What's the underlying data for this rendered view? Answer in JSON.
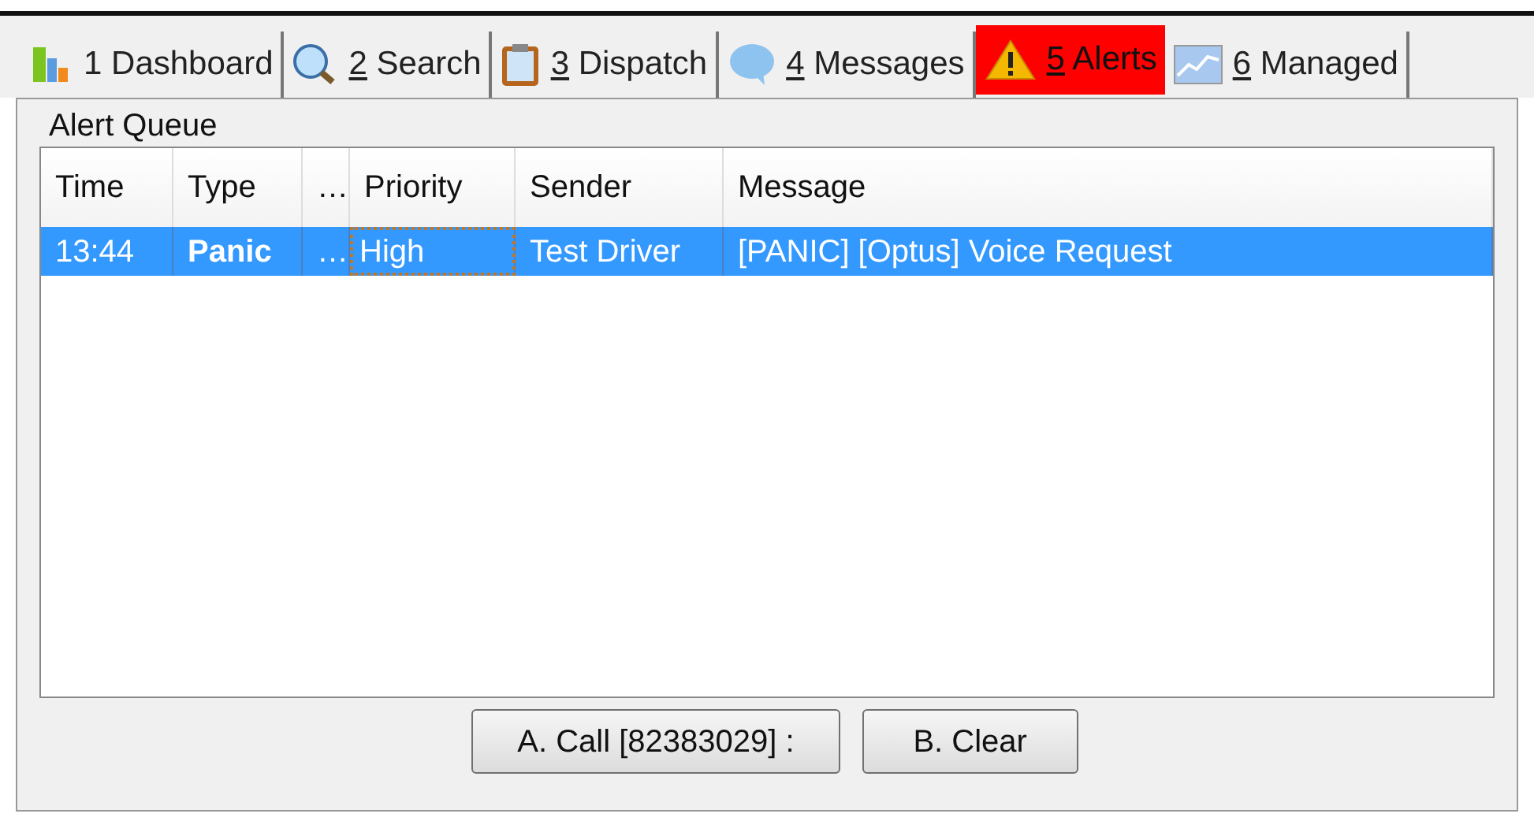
{
  "tabs": [
    {
      "kind": "chart",
      "key": "1",
      "label": "Dashboard",
      "underlined": false,
      "selected": false
    },
    {
      "kind": "search",
      "key": "2",
      "label": "Search",
      "underlined": true,
      "selected": false
    },
    {
      "kind": "clipboard",
      "key": "3",
      "label": "Dispatch",
      "underlined": true,
      "selected": false
    },
    {
      "kind": "bubble",
      "key": "4",
      "label": "Messages",
      "underlined": true,
      "selected": false
    },
    {
      "kind": "warning",
      "key": "5",
      "label": "Alerts",
      "underlined": true,
      "selected": true
    },
    {
      "kind": "graph",
      "key": "6",
      "label": "Managed",
      "underlined": true,
      "selected": false
    }
  ],
  "group": {
    "title": "Alert Queue"
  },
  "table": {
    "columns": [
      "Time",
      "Type",
      "…",
      "Priority",
      "Sender",
      "Message"
    ],
    "rows": [
      {
        "selected": true,
        "cells": [
          {
            "text": "13:44",
            "bold": false,
            "focused": false
          },
          {
            "text": "Panic",
            "bold": true,
            "focused": false
          },
          {
            "text": "…",
            "bold": false,
            "focused": false
          },
          {
            "text": "High",
            "bold": false,
            "focused": true
          },
          {
            "text": "Test Driver",
            "bold": false,
            "focused": false
          },
          {
            "text": "[PANIC] [Optus] Voice Request",
            "bold": false,
            "focused": false
          }
        ]
      }
    ]
  },
  "buttons": [
    "A. Call [82383029] :",
    "B. Clear"
  ]
}
